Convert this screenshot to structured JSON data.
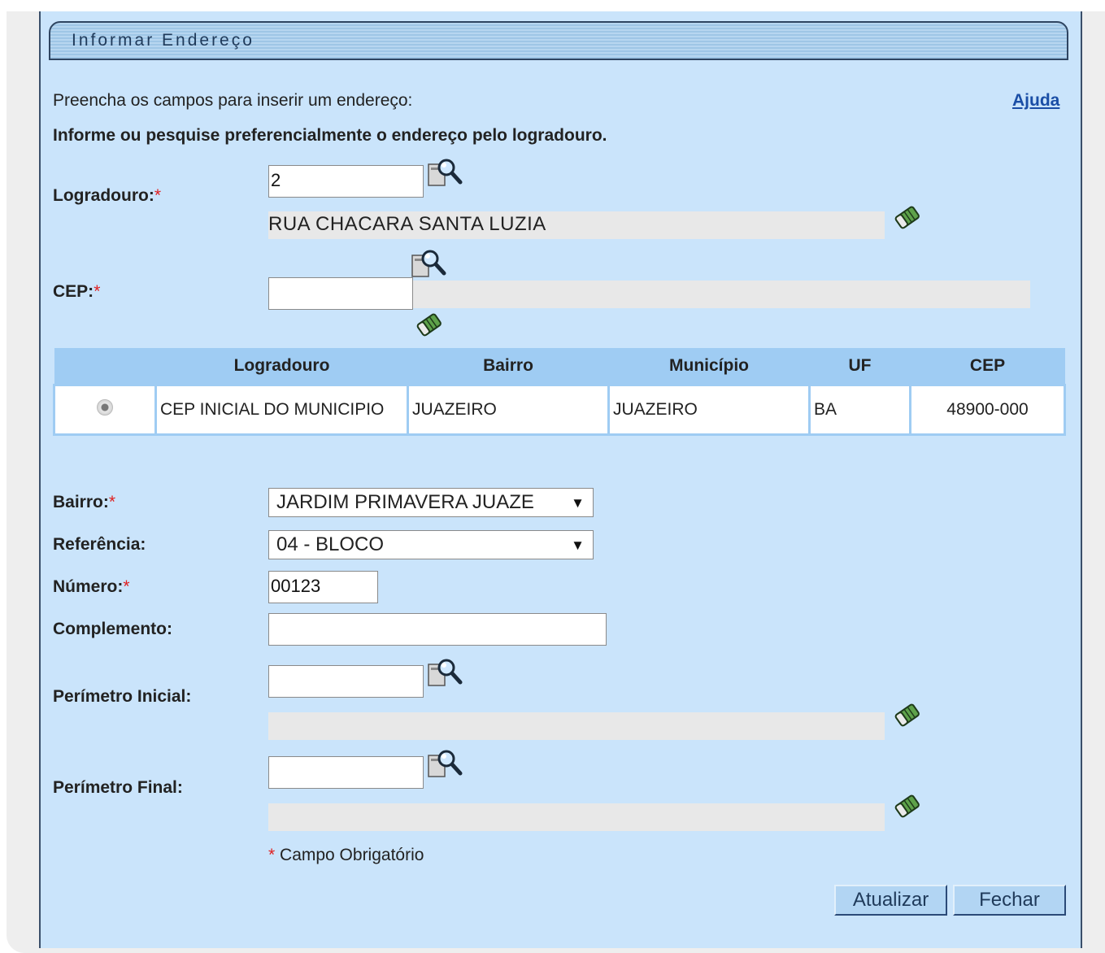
{
  "window": {
    "title": "Informar Endereço"
  },
  "intro": {
    "instructions": "Preencha os campos para inserir um endereço:",
    "help_link": "Ajuda",
    "hint": "Informe ou pesquise preferencialmente o endereço pelo logradouro."
  },
  "logradouro": {
    "label": "Logradouro:",
    "required_mark": "*",
    "code": "2",
    "description": "RUA CHACARA SANTA LUZIA"
  },
  "cep": {
    "label": "CEP:",
    "required_mark": "*",
    "value": "",
    "description": ""
  },
  "results_table": {
    "headers": [
      "",
      "Logradouro",
      "Bairro",
      "Município",
      "UF",
      "CEP"
    ],
    "rows": [
      {
        "logradouro": "CEP INICIAL DO MUNICIPIO",
        "bairro": "JUAZEIRO",
        "municipio": "JUAZEIRO",
        "uf": "BA",
        "cep": "48900-000"
      }
    ]
  },
  "bairro": {
    "label": "Bairro:",
    "required_mark": "*",
    "selected": "JARDIM PRIMAVERA JUAZE"
  },
  "referencia": {
    "label": "Referência:",
    "selected": "04 - BLOCO"
  },
  "numero": {
    "label": "Número:",
    "required_mark": "*",
    "value": "00123"
  },
  "complemento": {
    "label": "Complemento:",
    "value": ""
  },
  "perimetro_inicial": {
    "label": "Perímetro Inicial:",
    "code": "",
    "description": ""
  },
  "perimetro_final": {
    "label": "Perímetro Final:",
    "code": "",
    "description": ""
  },
  "footer": {
    "required_mark": "*",
    "required_note": " Campo Obrigatório",
    "update_button": "Atualizar",
    "close_button": "Fechar"
  }
}
